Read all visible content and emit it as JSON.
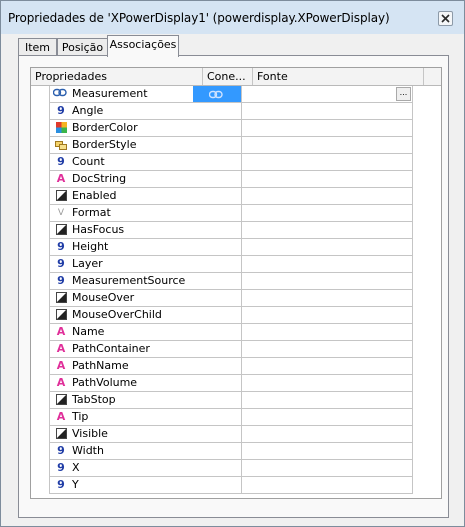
{
  "window": {
    "title": "Propriedades de 'XPowerDisplay1' (powerdisplay.XPowerDisplay)"
  },
  "tabs": [
    {
      "label": "Item"
    },
    {
      "label": "Posição"
    },
    {
      "label": "Associações"
    }
  ],
  "active_tab": "Associações",
  "table": {
    "columns": {
      "properties": "Propriedades",
      "connection": "Cone...",
      "source": "Fonte"
    },
    "selected_row": "Measurement",
    "source_button_label": "...",
    "rows": [
      {
        "name": "Measurement",
        "type": "link"
      },
      {
        "name": "Angle",
        "type": "number"
      },
      {
        "name": "BorderColor",
        "type": "color"
      },
      {
        "name": "BorderStyle",
        "type": "enum"
      },
      {
        "name": "Count",
        "type": "number"
      },
      {
        "name": "DocString",
        "type": "string"
      },
      {
        "name": "Enabled",
        "type": "boolean"
      },
      {
        "name": "Format",
        "type": "format"
      },
      {
        "name": "HasFocus",
        "type": "boolean"
      },
      {
        "name": "Height",
        "type": "number"
      },
      {
        "name": "Layer",
        "type": "number"
      },
      {
        "name": "MeasurementSource",
        "type": "number"
      },
      {
        "name": "MouseOver",
        "type": "boolean"
      },
      {
        "name": "MouseOverChild",
        "type": "boolean"
      },
      {
        "name": "Name",
        "type": "string"
      },
      {
        "name": "PathContainer",
        "type": "string"
      },
      {
        "name": "PathName",
        "type": "string"
      },
      {
        "name": "PathVolume",
        "type": "string"
      },
      {
        "name": "TabStop",
        "type": "boolean"
      },
      {
        "name": "Tip",
        "type": "string"
      },
      {
        "name": "Visible",
        "type": "boolean"
      },
      {
        "name": "Width",
        "type": "number"
      },
      {
        "name": "X",
        "type": "number"
      },
      {
        "name": "Y",
        "type": "number"
      }
    ]
  },
  "icons": {
    "number": {
      "name": "number-type-icon",
      "glyph": "9",
      "color": "#1f3ca6"
    },
    "string": {
      "name": "string-type-icon",
      "glyph": "A",
      "color": "#e0309a"
    },
    "boolean": {
      "name": "boolean-type-icon"
    },
    "format": {
      "name": "format-type-icon",
      "glyph": "V",
      "color": "#9a9a9a"
    },
    "color": {
      "name": "color-type-icon"
    },
    "enum": {
      "name": "enum-type-icon"
    },
    "link": {
      "name": "link-type-icon"
    }
  },
  "colors": {
    "selection": "#3399ff",
    "titlebar": "#d5e4f3"
  }
}
